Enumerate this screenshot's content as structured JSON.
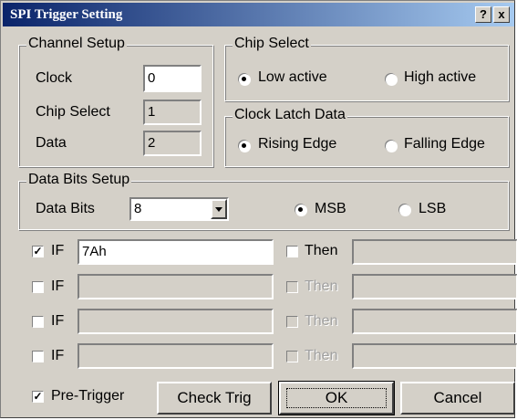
{
  "window": {
    "title": "SPI Trigger Setting",
    "help_label": "?",
    "close_label": "x"
  },
  "channel_setup": {
    "title": "Channel Setup",
    "clock_label": "Clock",
    "clock_value": "0",
    "chip_select_label": "Chip Select",
    "chip_select_value": "1",
    "data_label": "Data",
    "data_value": "2"
  },
  "chip_select": {
    "title": "Chip Select",
    "low_label": "Low active",
    "high_label": "High active",
    "selected": "low"
  },
  "clock_latch": {
    "title": "Clock Latch Data",
    "rising_label": "Rising Edge",
    "falling_label": "Falling Edge",
    "selected": "rising"
  },
  "data_bits_setup": {
    "title": "Data Bits Setup",
    "data_bits_label": "Data Bits",
    "data_bits_value": "8",
    "msb_label": "MSB",
    "lsb_label": "LSB",
    "selected": "MSB"
  },
  "conditions": [
    {
      "if_label": "IF",
      "if_checked": true,
      "if_value": "7Ah",
      "then_label": "Then",
      "then_enabled": true,
      "then_value": ""
    },
    {
      "if_label": "IF",
      "if_checked": false,
      "if_value": "",
      "then_label": "Then",
      "then_enabled": false,
      "then_value": ""
    },
    {
      "if_label": "IF",
      "if_checked": false,
      "if_value": "",
      "then_label": "Then",
      "then_enabled": false,
      "then_value": ""
    },
    {
      "if_label": "IF",
      "if_checked": false,
      "if_value": "",
      "then_label": "Then",
      "then_enabled": false,
      "then_value": ""
    }
  ],
  "pre_trigger": {
    "label": "Pre-Trigger",
    "checked": true
  },
  "buttons": {
    "check_trig": "Check Trig",
    "ok": "OK",
    "cancel": "Cancel"
  }
}
